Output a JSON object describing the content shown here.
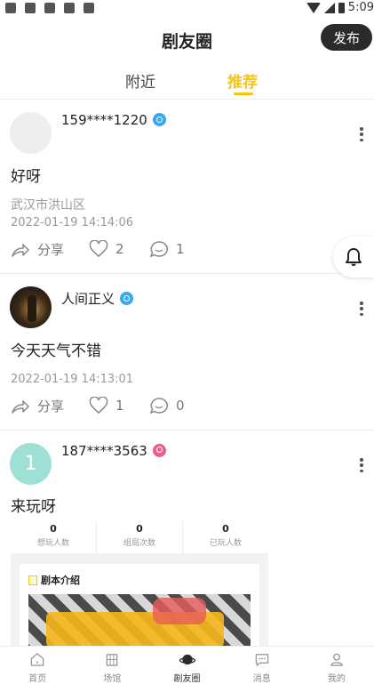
{
  "status_bar": {
    "time": "5:09"
  },
  "header": {
    "title": "剧友圈",
    "publish_label": "发布"
  },
  "tabs": [
    {
      "label": "附近",
      "active": false
    },
    {
      "label": "推荐",
      "active": true
    }
  ],
  "posts": [
    {
      "username": "159****1220",
      "gender": "male",
      "content": "好呀",
      "location": "武汉市洪山区",
      "time": "2022-01-19 14:14:06",
      "share_label": "分享",
      "likes": "2",
      "comments": "1"
    },
    {
      "username": "人间正义",
      "gender": "male",
      "content": "今天天气不错",
      "time": "2022-01-19 14:13:01",
      "share_label": "分享",
      "likes": "1",
      "comments": "0"
    },
    {
      "username": "187****3563",
      "gender": "female",
      "avatar_letter": "1",
      "content": "来玩呀",
      "card": {
        "stats": [
          {
            "value": "0",
            "label": "想玩人数"
          },
          {
            "value": "0",
            "label": "组局次数"
          },
          {
            "value": "0",
            "label": "已玩人数"
          }
        ],
        "intro_title": "剧本介绍"
      }
    }
  ],
  "bottom_nav": [
    {
      "label": "首页",
      "icon": "home-icon",
      "active": false
    },
    {
      "label": "场馆",
      "icon": "building-icon",
      "active": false
    },
    {
      "label": "剧友圈",
      "icon": "planet-icon",
      "active": true
    },
    {
      "label": "消息",
      "icon": "message-icon",
      "active": false
    },
    {
      "label": "我的",
      "icon": "user-icon",
      "active": false
    }
  ],
  "colors": {
    "accent": "#f5c518",
    "male": "#3ba6f2",
    "female": "#f25a8a"
  }
}
